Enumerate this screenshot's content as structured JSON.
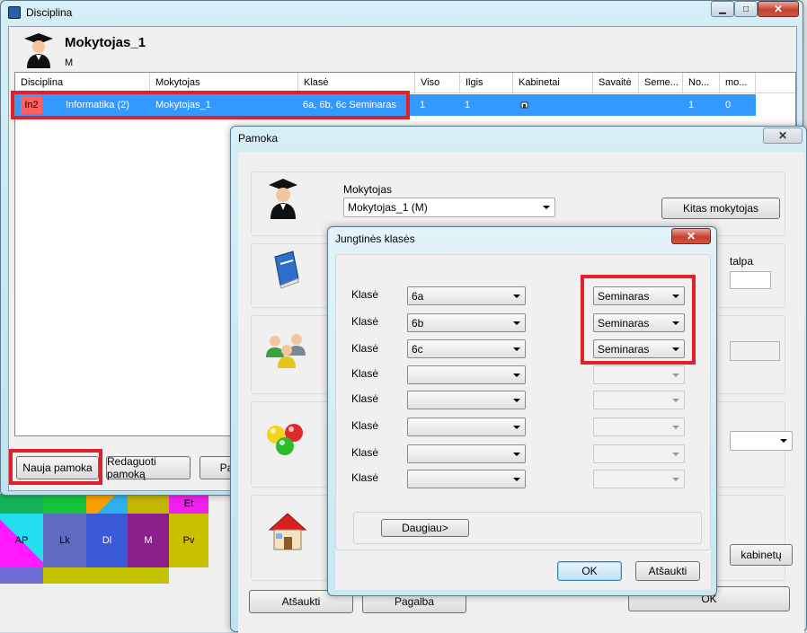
{
  "background_grid": {
    "cells": [
      "AP",
      "Lk",
      "Dl",
      "M",
      "Pv",
      "Et"
    ]
  },
  "main_window": {
    "title": "Disciplina",
    "teacher_name": "Mokytojas_1",
    "teacher_short": "M",
    "table": {
      "headers": [
        "Disciplina",
        "Mokytojas",
        "Klasė",
        "Viso",
        "Ilgis",
        "Kabinetai",
        "Savaitė",
        "Seme...",
        "No...",
        "mo..."
      ],
      "rows": [
        {
          "code": "In2",
          "discipline": "Informatika (2)",
          "teacher": "Mokytojas_1",
          "classes": "6a, 6b, 6c Seminaras",
          "total": "1",
          "length": "1",
          "rooms": "",
          "week": "",
          "semester": "",
          "no": "1",
          "mo": "0"
        }
      ]
    },
    "buttons": {
      "new_lesson": "Nauja pamoka",
      "edit_lesson": "Redaguoti pamoką",
      "third": "Pa"
    },
    "controls": {
      "minimize": "▁",
      "maximize": "□",
      "close": "✕"
    }
  },
  "lesson_window": {
    "title": "Pamoka",
    "teacher_label": "Mokytojas",
    "teacher_value": "Mokytojas_1 (M)",
    "other_teacher_button": "Kitas mokytojas",
    "room_label_fragment": "talpa",
    "rooms_button_fragment": "kabinetų",
    "cancel_button": "Atšaukti",
    "help_button": "Pagalba",
    "ok_button": "OK",
    "close": "✕"
  },
  "classes_dialog": {
    "title": "Jungtinės klasės",
    "close": "✕",
    "rows": [
      {
        "label": "Klasė",
        "class_value": "6a",
        "group_value": "Seminaras"
      },
      {
        "label": "Klasė",
        "class_value": "6b",
        "group_value": "Seminaras"
      },
      {
        "label": "Klasė",
        "class_value": "6c",
        "group_value": "Seminaras"
      },
      {
        "label": "Klasė",
        "class_value": "",
        "group_value": ""
      },
      {
        "label": "Klasė",
        "class_value": "",
        "group_value": ""
      },
      {
        "label": "Klasė",
        "class_value": "",
        "group_value": ""
      },
      {
        "label": "Klasė",
        "class_value": "",
        "group_value": ""
      },
      {
        "label": "Klasė",
        "class_value": "",
        "group_value": ""
      }
    ],
    "more_button": "Daugiau>",
    "ok_button": "OK",
    "cancel_button": "Atšaukti"
  }
}
